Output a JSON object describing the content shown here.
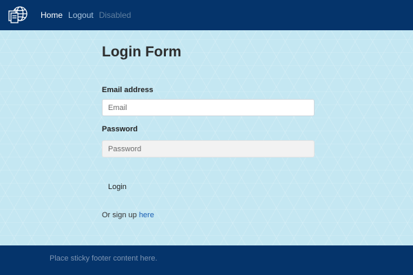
{
  "navbar": {
    "brand_icon": "globe-pages-icon",
    "links": [
      {
        "label": "Home"
      },
      {
        "label": "Logout"
      },
      {
        "label": "Disabled"
      }
    ]
  },
  "main": {
    "title": "Login Form",
    "email": {
      "label": "Email address",
      "placeholder": "Email",
      "value": ""
    },
    "password": {
      "label": "Password",
      "placeholder": "Password",
      "value": ""
    },
    "login_button": "Login",
    "signup_prefix": "Or sign up ",
    "signup_link": "here"
  },
  "footer": {
    "text": "Place sticky footer content here."
  },
  "colors": {
    "navbar_bg": "#05346b",
    "page_bg": "#c4e7f2",
    "link": "#1a5fb4"
  }
}
